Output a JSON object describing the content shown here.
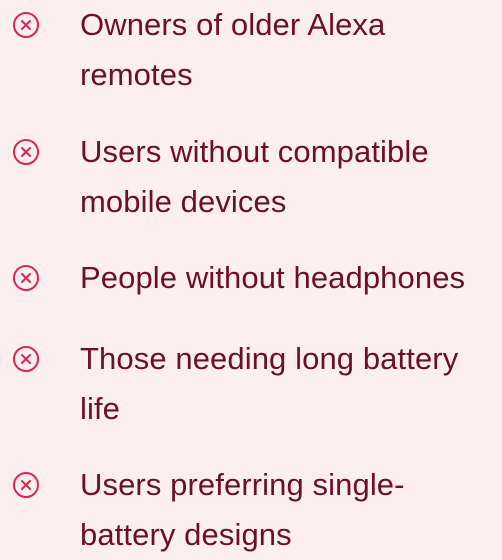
{
  "colors": {
    "background": "#fdeff0",
    "text": "#6b0f2a",
    "icon": "#d9284f"
  },
  "list": {
    "icon_name": "close-circle-icon",
    "items": [
      {
        "label": "Owners of older Alexa remotes"
      },
      {
        "label": "Users without compatible mobile devices"
      },
      {
        "label": "People without headphones"
      },
      {
        "label": "Those needing long battery life"
      },
      {
        "label": "Users preferring single-battery designs"
      }
    ]
  }
}
